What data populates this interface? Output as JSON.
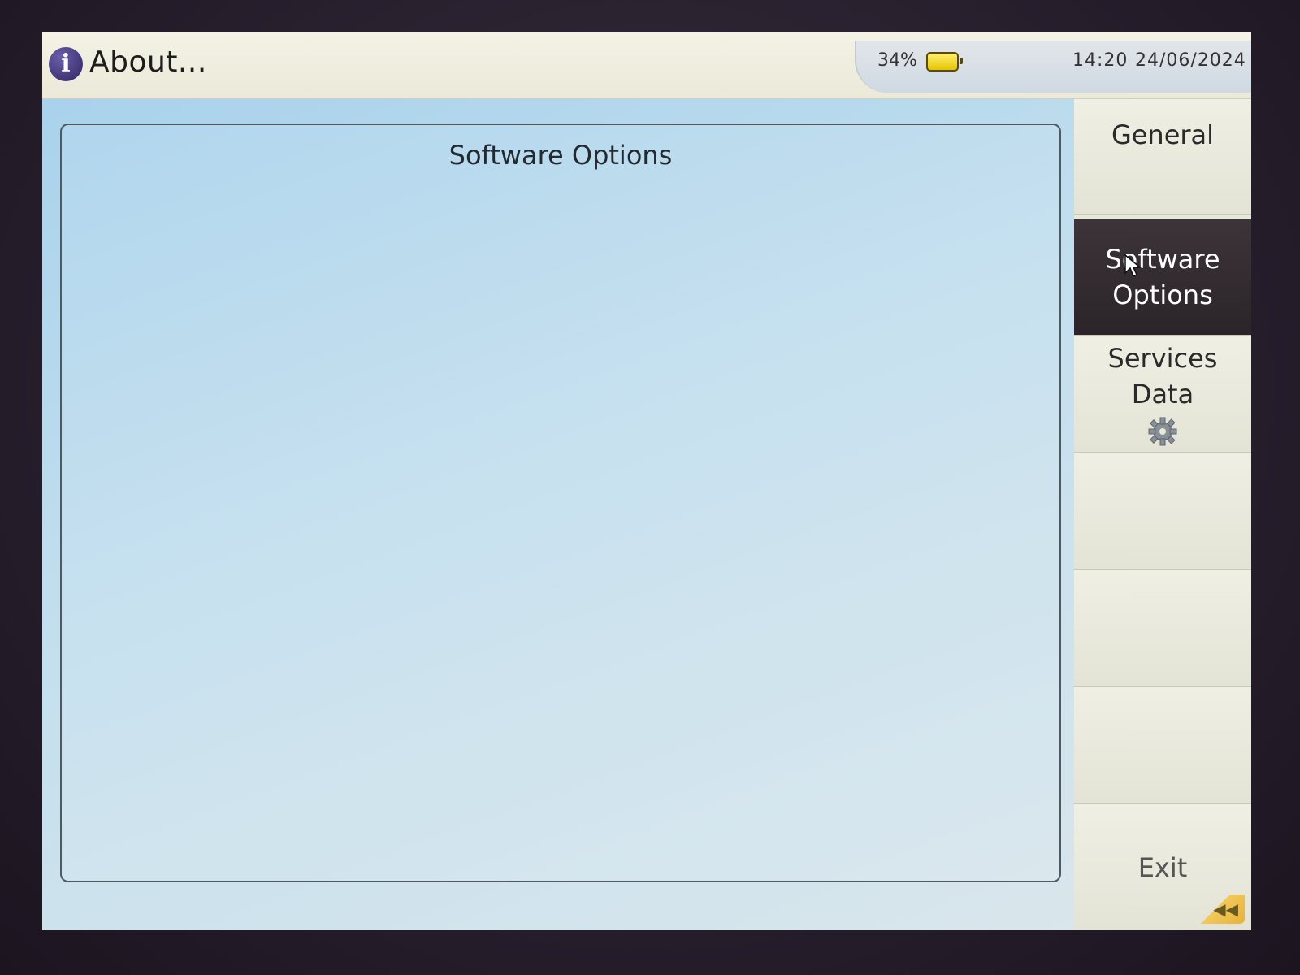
{
  "titlebar": {
    "title": "About...",
    "info_icon": "i",
    "battery_percent": "34%",
    "time": "14:20",
    "date": "24/06/2024"
  },
  "content": {
    "panel_title": "Software Options"
  },
  "sidemenu": {
    "items": [
      {
        "lines": [
          "General"
        ],
        "active": false
      },
      {
        "lines": [
          "Software",
          "Options"
        ],
        "active": true
      },
      {
        "lines": [
          "Services",
          "Data"
        ],
        "active": false,
        "icon": "gear-icon"
      },
      {
        "lines": [
          ""
        ],
        "active": false
      },
      {
        "lines": [
          ""
        ],
        "active": false
      },
      {
        "lines": [
          ""
        ],
        "active": false
      },
      {
        "lines": [
          "Exit"
        ],
        "active": false
      }
    ],
    "corner_icon": "rewind-icon",
    "corner_glyph": "◀◀"
  },
  "colors": {
    "active_button": "#2b2429",
    "content_bg": "#c3dfee",
    "battery": "#e5c500",
    "info_icon": "#2f2463"
  }
}
